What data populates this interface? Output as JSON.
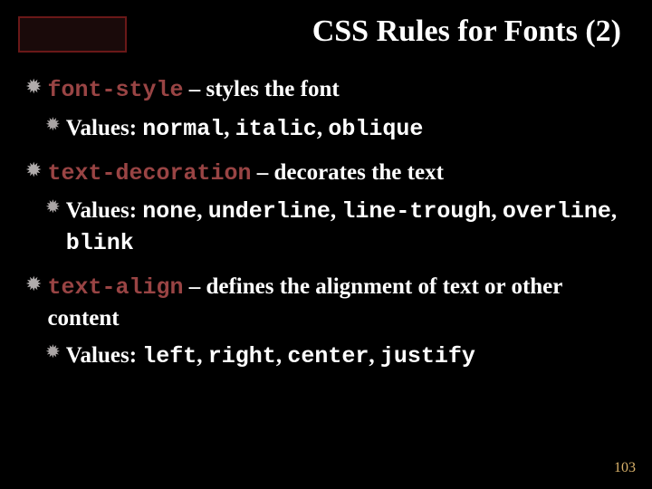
{
  "title": "CSS Rules for Fonts (2)",
  "items": [
    {
      "property": "font-style",
      "desc": "styles the font",
      "valuesLabel": "Values:",
      "values": [
        "normal",
        "italic",
        "oblique"
      ]
    },
    {
      "property": "text-decoration",
      "desc": "decorates the text",
      "valuesLabel": "Values:",
      "values": [
        "none",
        "underline",
        "line-trough",
        "overline",
        "blink"
      ]
    },
    {
      "property": "text-align",
      "desc": "defines the alignment of text or other content",
      "valuesLabel": "Values:",
      "values": [
        "left",
        "right",
        "center",
        "justify"
      ]
    }
  ],
  "pageNumber": "103"
}
